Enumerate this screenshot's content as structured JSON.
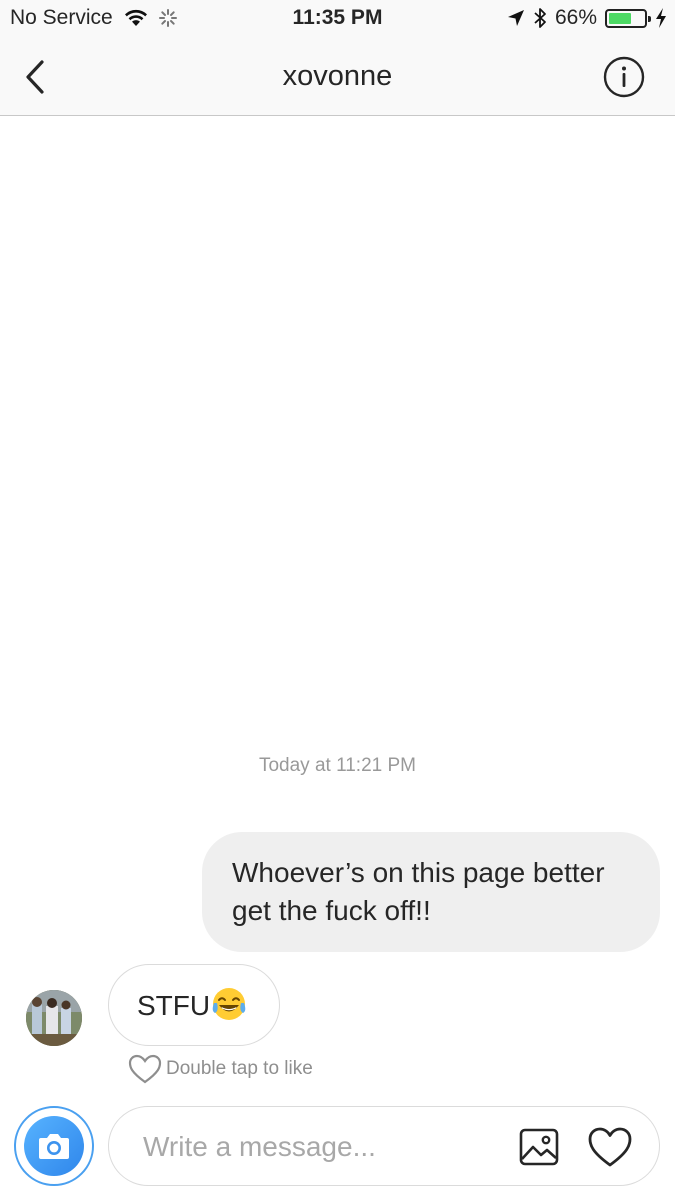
{
  "status_bar": {
    "carrier": "No Service",
    "time": "11:35 PM",
    "battery_percent": "66%",
    "battery_level": 0.66,
    "icons": [
      "wifi-icon",
      "activity-spinner-icon",
      "location-arrow-icon",
      "bluetooth-icon",
      "battery-icon",
      "charging-bolt-icon"
    ]
  },
  "nav": {
    "title": "xovonne",
    "icons": [
      "back-chevron-icon",
      "info-icon"
    ]
  },
  "conversation": {
    "timestamp": "Today at 11:21 PM",
    "messages": [
      {
        "direction": "outgoing",
        "text": "Whoever’s on this page better get the fuck off!!"
      },
      {
        "direction": "incoming",
        "text": "STFU",
        "emoji": "face-with-tears-of-joy"
      }
    ],
    "like_hint": "Double tap to like"
  },
  "composer": {
    "placeholder": "Write a message...",
    "icons": [
      "camera-icon",
      "gallery-icon",
      "heart-icon"
    ]
  },
  "colors": {
    "accent": "#3897f0",
    "bubble_out": "#efefef",
    "battery_green": "#4cd964"
  }
}
